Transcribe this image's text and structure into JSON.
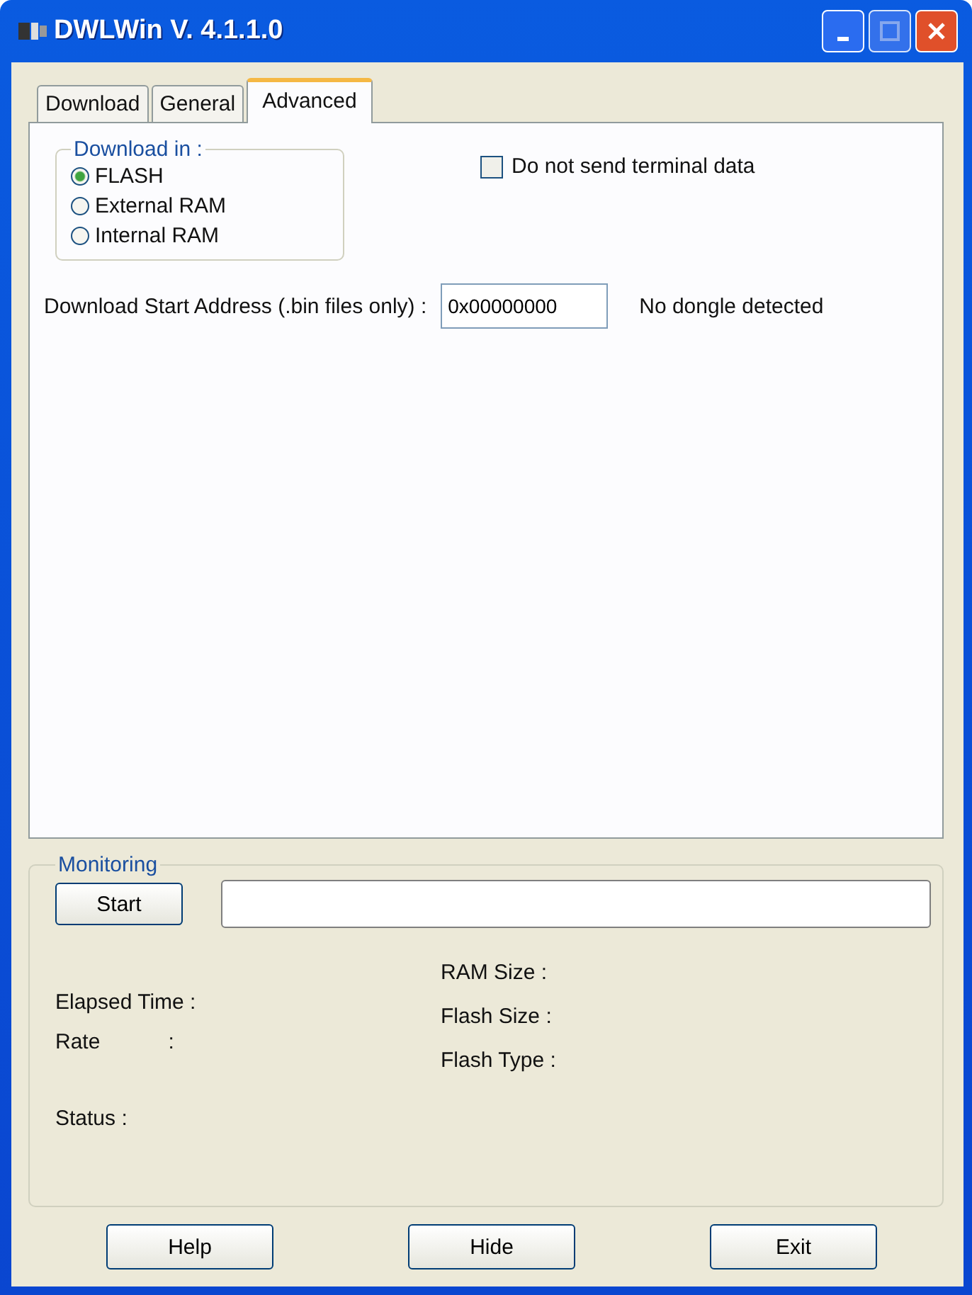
{
  "window": {
    "title": "DWLWin V. 4.1.1.0"
  },
  "tabs": [
    {
      "label": "Download",
      "selected": false
    },
    {
      "label": "General",
      "selected": false
    },
    {
      "label": "Advanced",
      "selected": true
    }
  ],
  "download_in": {
    "legend": "Download in :",
    "options": [
      {
        "label": "FLASH",
        "selected": true
      },
      {
        "label": "External RAM",
        "selected": false
      },
      {
        "label": "Internal RAM",
        "selected": false
      }
    ]
  },
  "terminal_checkbox": {
    "label": "Do not send terminal data",
    "checked": false
  },
  "start_address": {
    "label": "Download Start Address (.bin files only) :",
    "value": "0x00000000"
  },
  "dongle_status": "No dongle detected",
  "monitoring": {
    "legend": "Monitoring",
    "start_button": "Start",
    "left_fields": [
      {
        "label": "Elapsed Time :"
      },
      {
        "label": "Rate",
        "separator": ":"
      },
      {
        "label": "Status :"
      }
    ],
    "right_fields": [
      "RAM Size  :",
      "Flash Size  :",
      "Flash Type :"
    ]
  },
  "buttons": [
    "Help",
    "Hide",
    "Exit"
  ]
}
